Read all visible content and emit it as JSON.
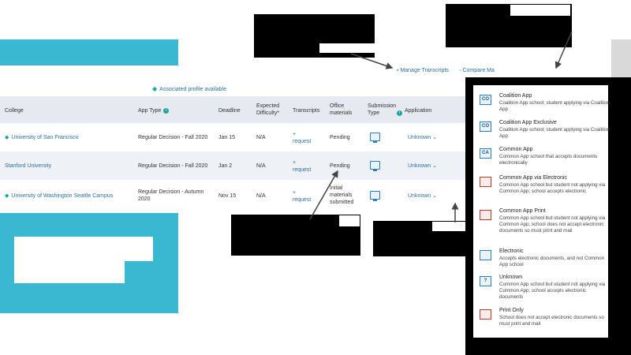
{
  "toolbar": {
    "manage_transcripts": "Manage Transcripts",
    "compare": "Compare Ma"
  },
  "profile_link": "Associated profile available",
  "table": {
    "headers": {
      "college": "College",
      "app_type": "App Type",
      "deadline": "Deadline",
      "expected_difficulty": "Expected Difficulty*",
      "transcripts": "Transcripts",
      "office_materials": "Office materials",
      "submission_type": "Submission Type",
      "application": "Application"
    },
    "rows": [
      {
        "college": "University of San Francisco",
        "app_type": "Regular Decision - Fall 2020",
        "deadline": "Jan 15",
        "difficulty": "N/A",
        "transcripts": "request",
        "office_materials": "Pending",
        "application": "Unknown"
      },
      {
        "college": "Stanford University",
        "app_type": "Regular Decision - Fall 2020",
        "deadline": "Jan 2",
        "difficulty": "N/A",
        "transcripts": "request",
        "office_materials": "Pending",
        "application": "Unknown"
      },
      {
        "college": "University of Washington Seattle Campus",
        "app_type": "Regular Decision - Autumn 2020",
        "deadline": "Nov 15",
        "difficulty": "N/A",
        "transcripts": "request",
        "office_materials": "Initial materials submitted",
        "application": "Unknown"
      }
    ]
  },
  "legend": [
    {
      "icon_text": "CO",
      "icon": "coalition-app-icon",
      "title": "Coalition App",
      "desc": "Coalition App school; student applying via Coalition App"
    },
    {
      "icon_text": "CO",
      "icon": "coalition-exclusive-icon",
      "title": "Coalition App Exclusive",
      "desc": "Coalition App school; student applying via Coalition App"
    },
    {
      "icon_text": "CA",
      "icon": "common-app-icon",
      "title": "Common App",
      "desc": "Common App school that accepts documents electronically"
    },
    {
      "icon_text": "",
      "icon": "common-app-electronic-icon",
      "title": "Common App via Electronic",
      "desc": "Common App school but student not applying via Common App; school accepts electronic"
    },
    {
      "icon_text": "",
      "icon": "common-app-print-icon",
      "title": "Common App Print",
      "desc": "Common App school but student not applying via Common App; school does not accept electronic documents so must print and mail"
    },
    {
      "icon_text": "",
      "icon": "electronic-icon",
      "title": "Electronic",
      "desc": "Accepts electronic documents, and not Common App school"
    },
    {
      "icon_text": "?",
      "icon": "unknown-icon",
      "title": "Unknown",
      "desc": "Common App school but student not applying via Common App; school accepts electronic documents"
    },
    {
      "icon_text": "",
      "icon": "print-only-icon",
      "title": "Print Only",
      "desc": "School does not accept electronic documents so must print and mail"
    }
  ],
  "colors": {
    "teal": "#3bb8d1",
    "link": "#2a6fa0",
    "header_bg": "#e6e9ef"
  }
}
